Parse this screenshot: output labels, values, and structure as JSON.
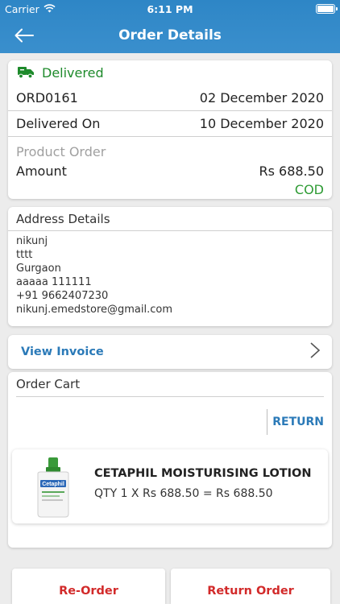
{
  "status_bar": {
    "carrier": "Carrier",
    "time": "6:11 PM"
  },
  "nav": {
    "title": "Order Details",
    "back_icon": "arrow-left-icon"
  },
  "order": {
    "status": "Delivered",
    "status_color": "#1e8a2b",
    "id": "ORD0161",
    "order_date": "02 December 2020",
    "delivered_label": "Delivered On",
    "delivered_date": "10 December 2020",
    "section_label": "Product Order",
    "amount_label": "Amount",
    "amount_value": "Rs 688.50",
    "payment_method": "COD"
  },
  "address": {
    "title": "Address Details",
    "lines": [
      "nikunj",
      "tttt",
      "Gurgaon",
      "aaaaa 111111",
      "+91 9662407230",
      "nikunj.emedstore@gmail.com"
    ]
  },
  "invoice": {
    "label": "View Invoice"
  },
  "cart": {
    "title": "Order Cart",
    "return_label": "RETURN",
    "item": {
      "name": "CETAPHIL MOISTURISING LOTION",
      "qty_line": "QTY 1 X Rs 688.50 = Rs 688.50",
      "image_brand": "Cetaphil"
    }
  },
  "actions": {
    "reorder": "Re-Order",
    "return_order": "Return Order"
  },
  "colors": {
    "header": "#3a8fcd",
    "link": "#2b7ab8",
    "danger": "#d22a2a",
    "success": "#2e9b34"
  }
}
